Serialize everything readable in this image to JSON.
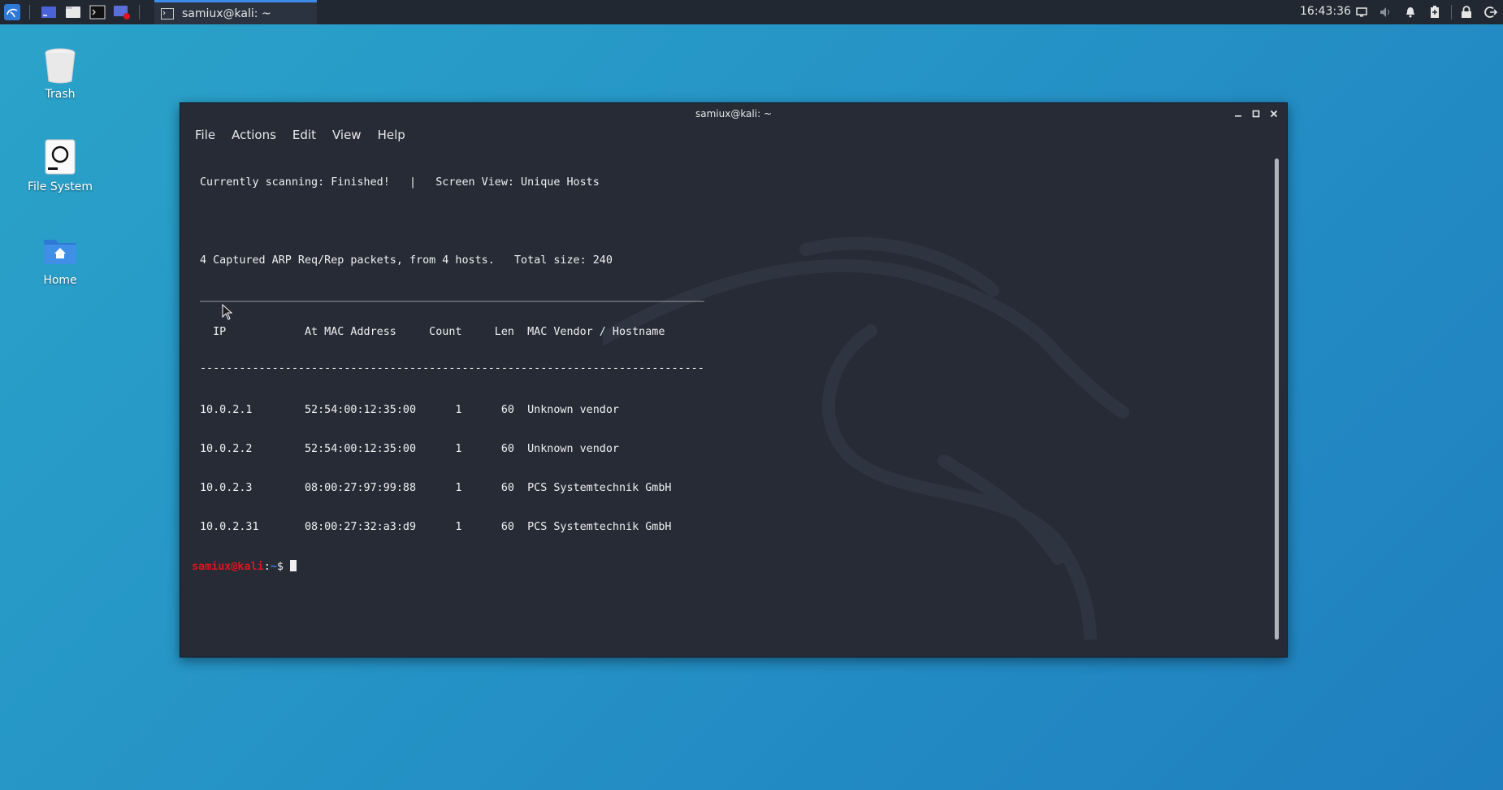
{
  "panel": {
    "task_title": "samiux@kali: ~",
    "clock": "16:43:36",
    "launchers": [
      "kali-menu-icon",
      "workspace-icon",
      "file-manager-icon",
      "terminal-icon",
      "screen-recorder-icon"
    ],
    "tray": [
      "display-icon",
      "volume-icon",
      "bell-icon",
      "battery-icon",
      "lock-icon",
      "logout-icon"
    ]
  },
  "desktop": {
    "icons": [
      {
        "label": "Trash"
      },
      {
        "label": "File System"
      },
      {
        "label": "Home"
      }
    ]
  },
  "window": {
    "title": "samiux@kali: ~",
    "menu": [
      "File",
      "Actions",
      "Edit",
      "View",
      "Help"
    ]
  },
  "terminal": {
    "status_line": "Currently scanning: Finished!   |   Screen View: Unique Hosts",
    "summary_line": "4 Captured ARP Req/Rep packets, from 4 hosts.   Total size: 240",
    "rule_top": "_____________________________________________________________________________",
    "header_line": "  IP            At MAC Address     Count     Len  MAC Vendor / Hostname",
    "rule_bottom": "-----------------------------------------------------------------------------",
    "rows": [
      "10.0.2.1        52:54:00:12:35:00      1      60  Unknown vendor",
      "10.0.2.2        52:54:00:12:35:00      1      60  Unknown vendor",
      "10.0.2.3        08:00:27:97:99:88      1      60  PCS Systemtechnik GmbH",
      "10.0.2.31       08:00:27:32:a3:d9      1      60  PCS Systemtechnik GmbH"
    ],
    "prompt_user": "samiux@kali",
    "prompt_sep": ":",
    "prompt_path": "~",
    "prompt_symbol": "$ "
  },
  "colors": {
    "desktop": "#2593c6",
    "terminal_bg": "#262b36",
    "prompt_user": "#e0141e",
    "prompt_path": "#3e7fe0",
    "accent": "#3c8be8"
  }
}
